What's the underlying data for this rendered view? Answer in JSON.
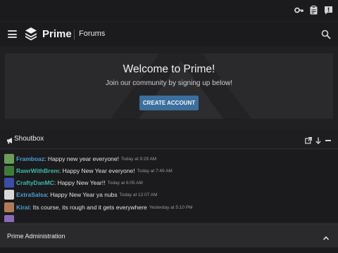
{
  "topbar": {
    "icons": [
      "key-icon",
      "clipboard-icon",
      "alert-message-icon"
    ]
  },
  "nav": {
    "brand": "Prime",
    "section": "Forums",
    "icons": [
      "hamburger-menu-icon",
      "prime-logo-icon",
      "search-icon"
    ]
  },
  "hero": {
    "title": "Welcome to Prime!",
    "subtitle": "Join our community by signing up below!",
    "button": "CREATE ACCOUNT"
  },
  "shoutbox": {
    "title": "Shoutbox",
    "tools": [
      "external-link-icon",
      "arrow-down-icon",
      "minimize-icon"
    ],
    "messages": [
      {
        "user": "Framboaz",
        "user_color": "#4b9fd6",
        "text": ": Happy new year everyone!",
        "time": "Today at 9:29 AM",
        "avatar_color": "#6a9d5a"
      },
      {
        "user": "RawrWithBrem",
        "user_color": "#3fb8a8",
        "text": ": Happy New Year everyone!",
        "time": "Today at 7:49 AM",
        "avatar_color": "#3f7a3a"
      },
      {
        "user": "CraftyDanMC",
        "user_color": "#3fb8a8",
        "text": ": Happy New Year!!",
        "time": "Today at 6:05 AM",
        "avatar_color": "#3a4da8"
      },
      {
        "user": "ExtraSalsa",
        "user_color": "#4b9fd6",
        "text": ": Happy New Year ya nubs",
        "time": "Today at 12:07 AM",
        "avatar_color": "#d8d8d8"
      },
      {
        "user": "Kirai",
        "user_color": "#4b9fd6",
        "text": ": Its course, its rough and it gets everywhere",
        "time": "Yesterday at 5:10 PM",
        "avatar_color": "#b07a5a"
      }
    ]
  },
  "admin": {
    "title": "Prime Administration"
  },
  "colors": {
    "background": "#202022",
    "bar": "#1b1b1d",
    "panel": "#2a2a2c",
    "accent": "#3c6f9e"
  }
}
